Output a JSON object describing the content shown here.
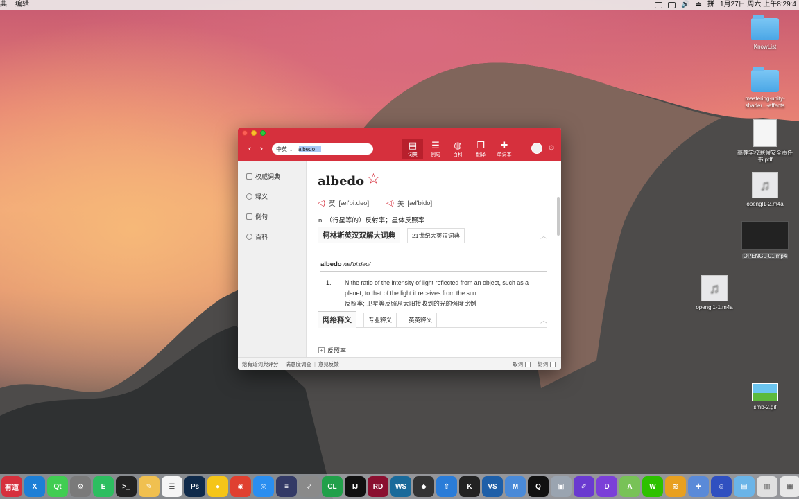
{
  "menubar": {
    "app_name": "典",
    "menu_edit": "编辑",
    "clock": "1月27日 周六 上午8:29:4"
  },
  "desktop_icons": [
    {
      "label": "KnowList",
      "kind": "folder"
    },
    {
      "label": "mastering-unity-shader...-effects",
      "kind": "folder"
    },
    {
      "label": "高等学校寒假安全责任书.pdf",
      "kind": "pdf"
    },
    {
      "label": "opengl1-2.m4a",
      "kind": "audio"
    },
    {
      "label": "OPENGL-01.mp4",
      "kind": "video"
    },
    {
      "label": "opengl1-1.m4a",
      "kind": "audio"
    },
    {
      "label": "smb-2.gif",
      "kind": "gif"
    }
  ],
  "window": {
    "search": {
      "lang": "中英",
      "query": "albedo"
    },
    "toolbar": [
      {
        "label": "词典",
        "icon": "book-icon",
        "active": true
      },
      {
        "label": "例句",
        "icon": "list-icon",
        "active": false
      },
      {
        "label": "百科",
        "icon": "globe-icon",
        "active": false
      },
      {
        "label": "翻译",
        "icon": "translate-icon",
        "active": false
      },
      {
        "label": "单词本",
        "icon": "bookmark-icon",
        "active": false
      }
    ],
    "sidebar": [
      {
        "label": "权威词典",
        "icon": "page-icon"
      },
      {
        "label": "释义",
        "icon": "globe-icon"
      },
      {
        "label": "例句",
        "icon": "page-icon"
      },
      {
        "label": "百科",
        "icon": "compass-icon"
      }
    ],
    "entry": {
      "word": "albedo",
      "uk_label": "英",
      "uk_phonetic": "[æl'biːdəʊ]",
      "us_label": "美",
      "us_phonetic": "[æl'bido]",
      "definition": "n. （行星等的）反射率；星体反照率"
    },
    "dict_tabs": [
      "柯林斯英汉双解大词典",
      "21世纪大英汉词典"
    ],
    "collins": {
      "headword": "albedo",
      "phonetic": "/æl'biːdəʊ/",
      "sense_number": "1.",
      "sense_en": "N the ratio of the intensity of light reflected from an object, such as a planet, to that of the light it receives from the sun",
      "sense_zh": "反照率; 卫星等反照从太阳接收到的光的强度比例"
    },
    "net_tabs": [
      "网络释义",
      "专业释义",
      "英英释义"
    ],
    "net_item": "反照率",
    "statusbar": {
      "rate": "给有道词典评分",
      "survey": "满意度调查",
      "feedback": "意见反馈",
      "pick_word": "取词",
      "select_word": "划词"
    }
  },
  "dock_apps": [
    {
      "label": "有道",
      "color": "#d6303d"
    },
    {
      "label": "X",
      "color": "#1d7fd6"
    },
    {
      "label": "Qt",
      "color": "#41cd52"
    },
    {
      "label": "⚙",
      "color": "#7a7a7a"
    },
    {
      "label": "E",
      "color": "#2dbe60"
    },
    {
      "label": ">_",
      "color": "#222222"
    },
    {
      "label": "✎",
      "color": "#f0c050"
    },
    {
      "label": "☰",
      "color": "#f5f5f5"
    },
    {
      "label": "Ps",
      "color": "#0f2a4a"
    },
    {
      "label": "●",
      "color": "#f5c518"
    },
    {
      "label": "◉",
      "color": "#e04030"
    },
    {
      "label": "◎",
      "color": "#2a8ef0"
    },
    {
      "label": "≡",
      "color": "#333a66"
    },
    {
      "label": "➶",
      "color": "#8a8a8a"
    },
    {
      "label": "CL",
      "color": "#21a04a"
    },
    {
      "label": "IJ",
      "color": "#101010"
    },
    {
      "label": "RD",
      "color": "#8a1030"
    },
    {
      "label": "WS",
      "color": "#1a6a9a"
    },
    {
      "label": "◆",
      "color": "#333333"
    },
    {
      "label": "⇧",
      "color": "#2a7cd8"
    },
    {
      "label": "K",
      "color": "#222222"
    },
    {
      "label": "VS",
      "color": "#1e5fa8"
    },
    {
      "label": "M",
      "color": "#4a8ad8"
    },
    {
      "label": "Q",
      "color": "#111111"
    },
    {
      "label": "▣",
      "color": "#9aa4b0"
    },
    {
      "label": "✐",
      "color": "#6a3ad0"
    },
    {
      "label": "D",
      "color": "#7b3fd8"
    },
    {
      "label": "A",
      "color": "#78c257"
    },
    {
      "label": "W",
      "color": "#2dc100"
    },
    {
      "label": "≋",
      "color": "#e8a020"
    },
    {
      "label": "✚",
      "color": "#5a8ad8"
    },
    {
      "label": "☺",
      "color": "#3050c0"
    },
    {
      "label": "▤",
      "color": "#6ab4e8"
    },
    {
      "label": "▥",
      "color": "#e0e0e0"
    },
    {
      "label": "▦",
      "color": "#e8e8e8"
    }
  ]
}
